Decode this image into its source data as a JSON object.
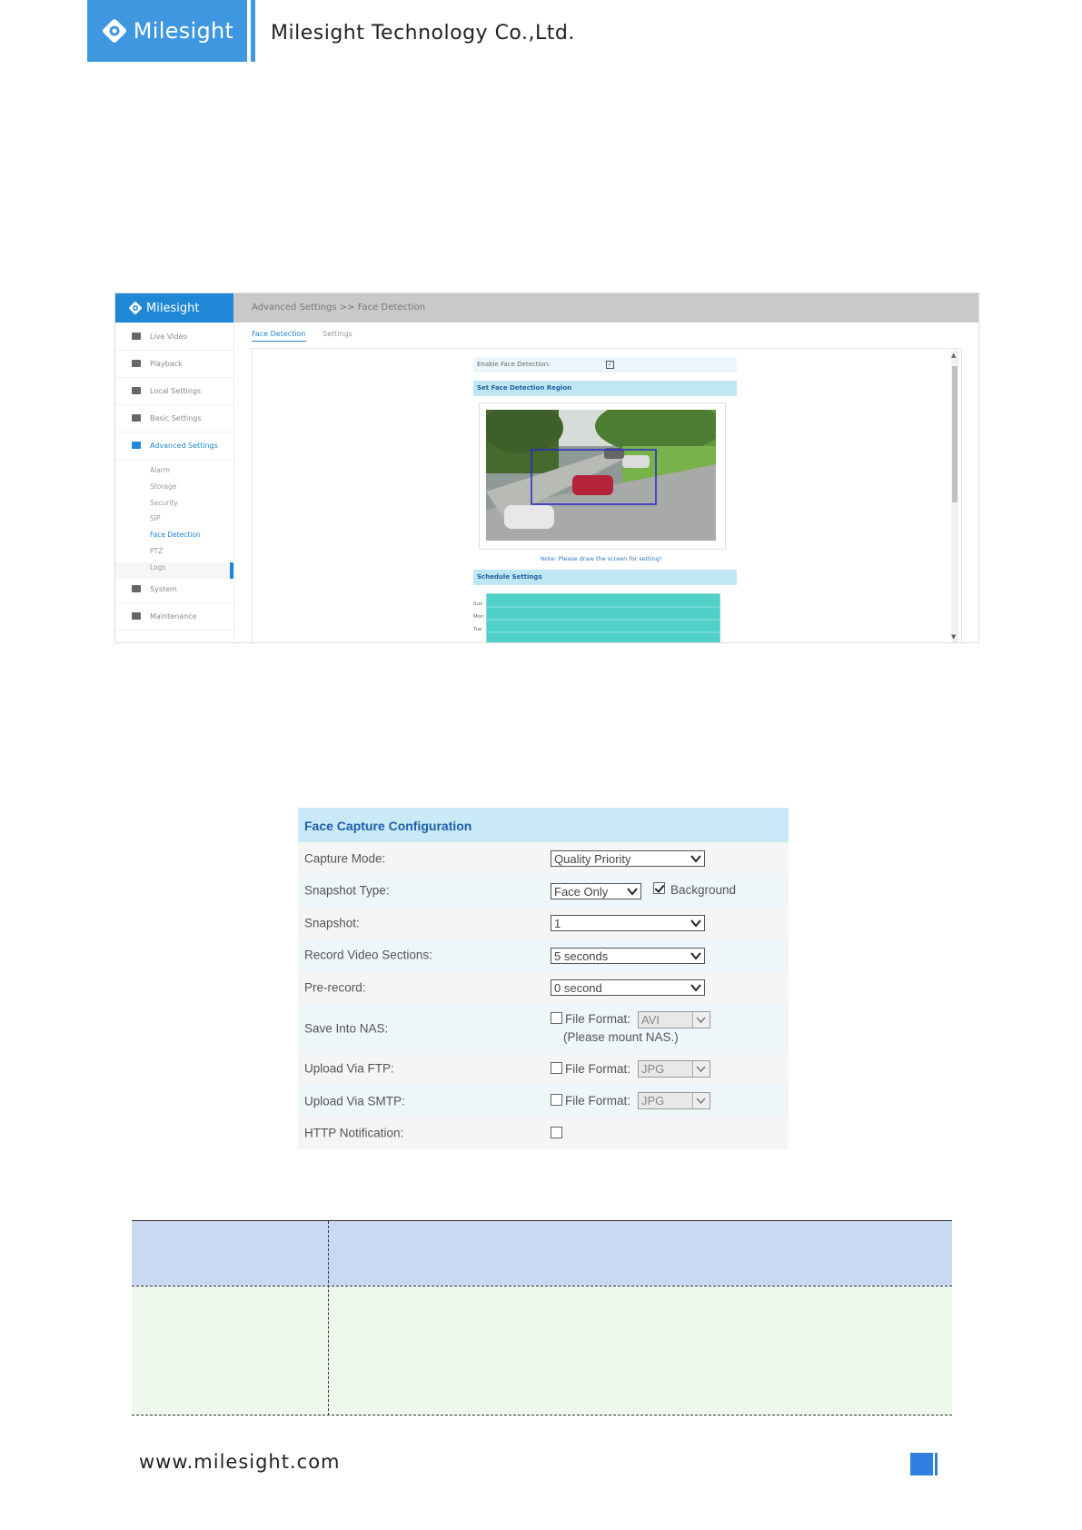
{
  "header": {
    "logo_text": "Milesight",
    "company": "Milesight Technology Co.,Ltd."
  },
  "screenshot": {
    "logo_text": "Milesight",
    "breadcrumb": "Advanced Settings >> Face Detection",
    "nav": [
      "Live Video",
      "Playback",
      "Local Settings",
      "Basic Settings",
      "Advanced Settings"
    ],
    "sub_nav": [
      "Alarm",
      "Storage",
      "Security",
      "SIP",
      "Face Detection",
      "PTZ",
      "Logs"
    ],
    "nav_bottom": [
      "System",
      "Maintenance"
    ],
    "tabs": [
      "Face Detection",
      "Settings"
    ],
    "enable_label": "Enable Face Detection:",
    "region_title": "Set Face Detection Region",
    "note": "Note: Please draw the screen for setting!",
    "schedule_title": "Schedule Settings",
    "days": [
      "Sun",
      "Mon",
      "Tue"
    ]
  },
  "face_capture": {
    "title": "Face Capture Configuration",
    "capture_mode": {
      "label": "Capture Mode:",
      "value": "Quality Priority"
    },
    "snapshot_type": {
      "label": "Snapshot Type:",
      "value": "Face Only",
      "background_label": "Background",
      "background_checked": true
    },
    "snapshot": {
      "label": "Snapshot:",
      "value": "1"
    },
    "record_sections": {
      "label": "Record Video Sections:",
      "value": "5 seconds"
    },
    "pre_record": {
      "label": "Pre-record:",
      "value": "0 second"
    },
    "nas": {
      "label": "Save Into NAS:",
      "format_label": "File Format:",
      "format": "AVI",
      "hint": "(Please mount NAS.)"
    },
    "ftp": {
      "label": "Upload Via FTP:",
      "format_label": "File Format:",
      "format": "JPG"
    },
    "smtp": {
      "label": "Upload Via SMTP:",
      "format_label": "File Format:",
      "format": "JPG"
    },
    "http": {
      "label": "HTTP Notification:"
    }
  },
  "footer": {
    "url": "www.milesight.com"
  },
  "colors": {
    "brand": "#3f97e0",
    "table_head": "#c9d9f1",
    "table_body": "#eef7ec"
  }
}
